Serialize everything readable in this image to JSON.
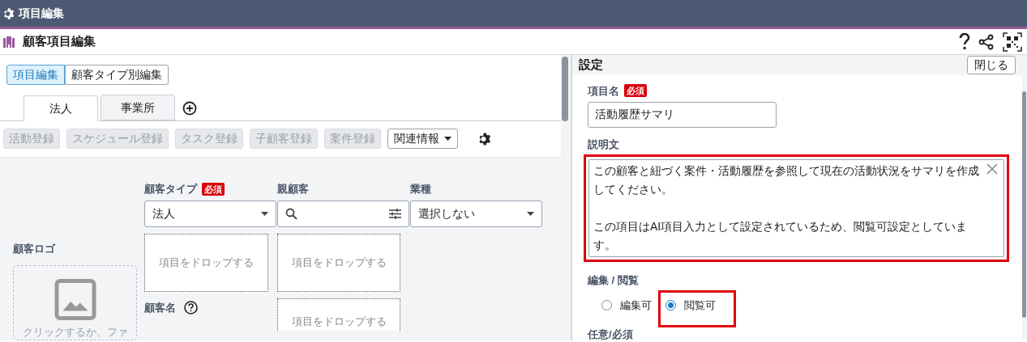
{
  "window": {
    "title": "項目編集"
  },
  "header": {
    "title": "顧客項目編集"
  },
  "mode_tabs": [
    {
      "label": "項目編集",
      "selected": true
    },
    {
      "label": "顧客タイプ別編集",
      "selected": false
    }
  ],
  "type_tabs": [
    {
      "label": "法人",
      "selected": true
    },
    {
      "label": "事業所",
      "selected": false
    }
  ],
  "action_buttons": [
    {
      "label": "活動登録",
      "disabled": true
    },
    {
      "label": "スケジュール登録",
      "disabled": true
    },
    {
      "label": "タスク登録",
      "disabled": true
    },
    {
      "label": "子顧客登録",
      "disabled": true
    },
    {
      "label": "案件登録",
      "disabled": true
    }
  ],
  "related_dropdown": {
    "label": "関連情報"
  },
  "form": {
    "logo_label": "顧客ロゴ",
    "logo_hint": "クリックするか、ファ",
    "fields": [
      {
        "label": "顧客タイプ",
        "badge": "必須",
        "kind": "select",
        "value": "法人"
      },
      {
        "label": "親顧客",
        "kind": "search"
      },
      {
        "label": "業種",
        "kind": "select",
        "value": "選択しない"
      }
    ],
    "drop_zones": [
      "項目をドロップする",
      "項目をドロップする",
      "項目をドロップする"
    ],
    "name_label": "顧客名"
  },
  "settings": {
    "title": "設定",
    "close_button": "閉じる",
    "item_name": {
      "label": "項目名",
      "required_badge": "必須",
      "value": "活動履歴サマリ"
    },
    "description": {
      "label": "説明文",
      "paragraphs": [
        "この顧客と紐づく案件・活動履歴を参照して現在の活動状況をサマリを作成してください。",
        "この項目はAI項目入力として設定されているため、閲覧可設定としています。"
      ],
      "highlighted": true
    },
    "edit_view": {
      "label": "編集 / 閲覧",
      "options": [
        {
          "label": "編集可",
          "selected": false,
          "highlighted": false
        },
        {
          "label": "閲覧可",
          "selected": true,
          "highlighted": true
        }
      ]
    },
    "optional_label": "任意/必須"
  }
}
